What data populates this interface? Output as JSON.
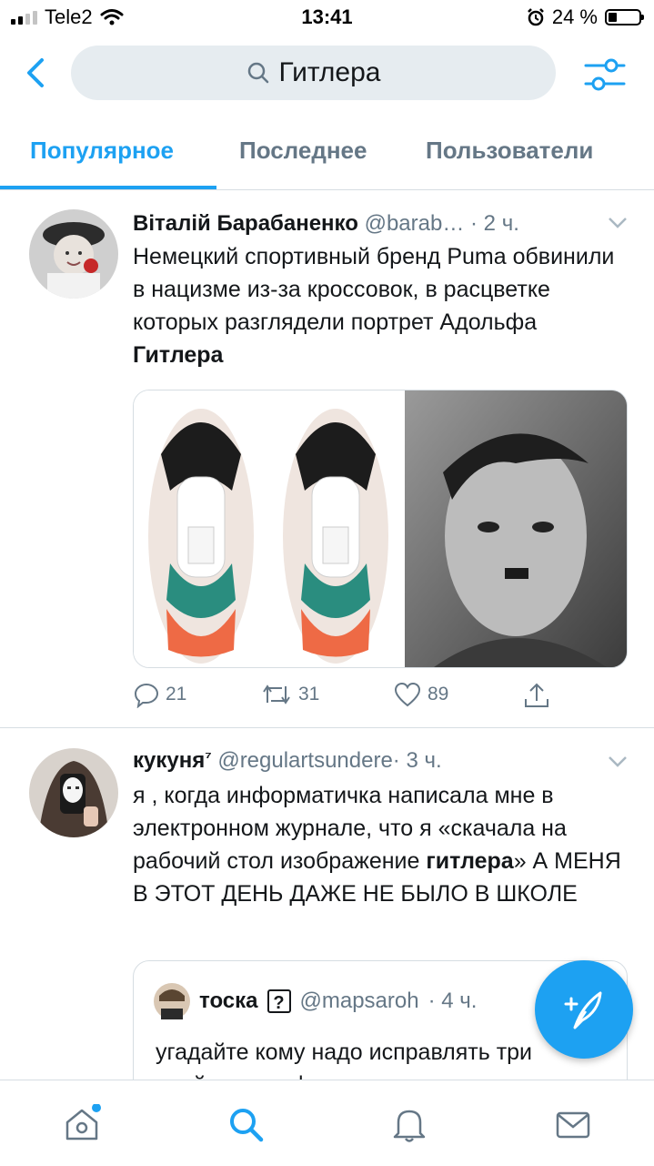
{
  "status_bar": {
    "carrier": "Tele2",
    "time": "13:41",
    "battery_percent": "24 %",
    "battery_level": 0.24
  },
  "search": {
    "query": "Гитлера"
  },
  "tabs": [
    {
      "label": "Популярное",
      "active": true
    },
    {
      "label": "Последнее",
      "active": false
    },
    {
      "label": "Пользователи",
      "active": false
    }
  ],
  "tweets": [
    {
      "name": "Віталій Барабаненко",
      "handle": "@barab…",
      "time": "· 2 ч.",
      "text_plain": "Немецкий спортивный бренд Puma обвинили в нацизме из-за кроссовок, в расцветке которых разглядели портрет Адольфа ",
      "text_bold": "Гитлера",
      "counts": {
        "replies": "21",
        "retweets": "31",
        "likes": "89"
      }
    },
    {
      "name": "кукуня",
      "name_suffix": "⁷",
      "handle": "@regulartsundere",
      "time": "· 3 ч.",
      "text_plain": "я , когда информатичка написала мне в электронном журнале, что я «скачала на рабочий стол изображение ",
      "text_bold": "гитлера",
      "text_after": "» А МЕНЯ В ЭТОТ ДЕНЬ ДАЖЕ НЕ БЫЛО В ШКОЛЕ",
      "quote": {
        "name": "тоска",
        "badge": "?",
        "handle": "@mapsaroh",
        "time": "· 4 ч.",
        "text": "угадайте кому надо исправлять три двойки по инфе"
      }
    }
  ],
  "colors": {
    "accent": "#1da1f2",
    "secondary_text": "#657786",
    "divider": "#d6dde2",
    "search_bg": "#e6ecf0"
  },
  "icons": [
    "back-icon",
    "search-icon",
    "filter-icon",
    "chevron-down-icon",
    "reply-icon",
    "retweet-icon",
    "like-icon",
    "share-icon",
    "compose-icon",
    "home-icon",
    "bell-icon",
    "mail-icon"
  ]
}
